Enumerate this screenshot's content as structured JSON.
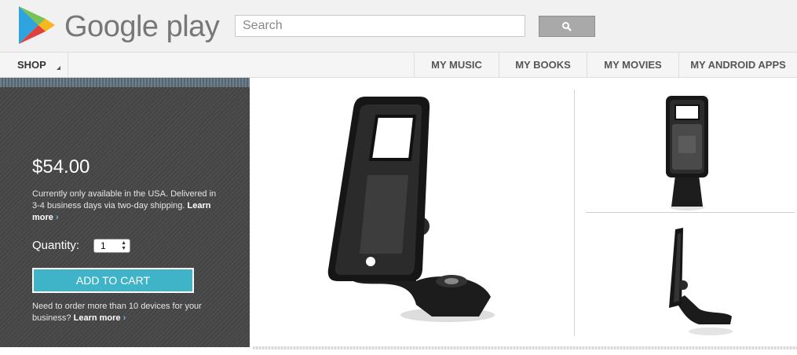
{
  "header": {
    "brand": "Google play",
    "search_placeholder": "Search"
  },
  "nav": {
    "shop": "SHOP",
    "items": [
      "MY MUSIC",
      "MY BOOKS",
      "MY MOVIES",
      "MY ANDROID APPS"
    ]
  },
  "product": {
    "price": "$54.00",
    "availability": "Currently only available in the USA. Delivered in 3-4 business days via two-day shipping.",
    "learn_more": "Learn more",
    "chevron": "›",
    "quantity_label": "Quantity:",
    "quantity_value": "1",
    "add_to_cart": "ADD TO CART",
    "bulk_text": "Need to order more than 10 devices for your business?",
    "bulk_learn_more": "Learn more"
  },
  "colors": {
    "accent": "#3fb3c7",
    "panel": "#474747"
  }
}
